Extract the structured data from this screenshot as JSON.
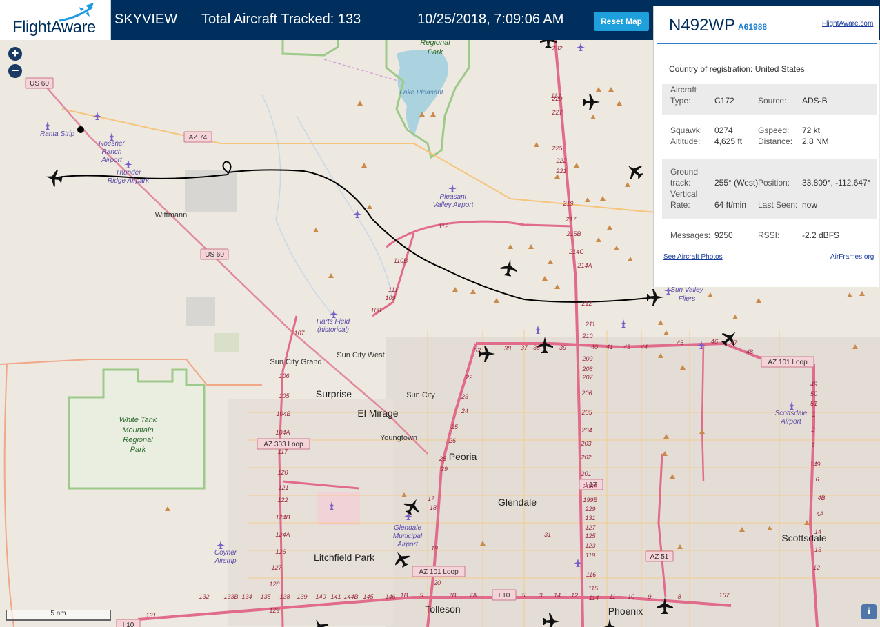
{
  "header": {
    "logo_text": "FlightAware",
    "title": "SKYVIEW",
    "total_label": "Total Aircraft Tracked: 133",
    "datetime": "10/25/2018, 7:09:06 AM",
    "reset_button": "Reset Map"
  },
  "map": {
    "zoom_in": "+",
    "zoom_out": "−",
    "scale_label": "5 nm",
    "info_button": "i",
    "place_labels": [
      {
        "text": "Regional",
        "cls": "park"
      },
      {
        "text": "Park",
        "cls": "park"
      },
      {
        "text": "Lake Pleasant",
        "cls": "water"
      },
      {
        "text": "US 60",
        "cls": "shield"
      },
      {
        "text": "Ranta Strip",
        "cls": "airport"
      },
      {
        "text": "Roesner",
        "cls": "airport"
      },
      {
        "text": "Ranch",
        "cls": "airport"
      },
      {
        "text": "Airport",
        "cls": "airport"
      },
      {
        "text": "AZ 74",
        "cls": "shield"
      },
      {
        "text": "Thunder",
        "cls": "airport"
      },
      {
        "text": "Ridge Airpark",
        "cls": "airport"
      },
      {
        "text": "Pleasant",
        "cls": "airport"
      },
      {
        "text": "Valley Airport",
        "cls": "airport"
      },
      {
        "text": "Wittmann",
        "cls": "town"
      },
      {
        "text": "US 60",
        "cls": "shield"
      },
      {
        "text": "Harts Field",
        "cls": "airport"
      },
      {
        "text": "(historical)",
        "cls": "airport"
      },
      {
        "text": "Sun City Grand",
        "cls": "town"
      },
      {
        "text": "Sun City West",
        "cls": "town"
      },
      {
        "text": "Surprise",
        "cls": "city"
      },
      {
        "text": "Sun City",
        "cls": "town"
      },
      {
        "text": "El Mirage",
        "cls": "city"
      },
      {
        "text": "Youngtown",
        "cls": "town"
      },
      {
        "text": "White Tank",
        "cls": "park"
      },
      {
        "text": "Mountain",
        "cls": "park"
      },
      {
        "text": "Regional",
        "cls": "park"
      },
      {
        "text": "Park",
        "cls": "park"
      },
      {
        "text": "AZ 303 Loop",
        "cls": "shield"
      },
      {
        "text": "Peoria",
        "cls": "city"
      },
      {
        "text": "Glendale",
        "cls": "city"
      },
      {
        "text": "Glendale",
        "cls": "airport"
      },
      {
        "text": "Municipal",
        "cls": "airport"
      },
      {
        "text": "Airport",
        "cls": "airport"
      },
      {
        "text": "Coyner",
        "cls": "airport"
      },
      {
        "text": "Airstrip",
        "cls": "airport"
      },
      {
        "text": "Litchfield Park",
        "cls": "city"
      },
      {
        "text": "AZ 101 Loop",
        "cls": "shield"
      },
      {
        "text": "Tolleson",
        "cls": "city"
      },
      {
        "text": "I 10",
        "cls": "shield"
      },
      {
        "text": "I 17",
        "cls": "shield"
      },
      {
        "text": "AZ 51",
        "cls": "shield"
      },
      {
        "text": "Phoenix",
        "cls": "city"
      },
      {
        "text": "Sun Valley",
        "cls": "airport"
      },
      {
        "text": "Fliers",
        "cls": "airport"
      },
      {
        "text": "AZ 101 Loop",
        "cls": "shield"
      },
      {
        "text": "Scottsdale",
        "cls": "airport"
      },
      {
        "text": "Airport",
        "cls": "airport"
      },
      {
        "text": "Scottsdale",
        "cls": "city"
      },
      {
        "text": "I 10",
        "cls": "shield"
      }
    ],
    "exit_numbers": [
      "232",
      "229",
      "227",
      "225",
      "222",
      "221",
      "219",
      "217",
      "215B",
      "214C",
      "214A",
      "212",
      "211",
      "210",
      "209",
      "208",
      "207",
      "206",
      "205",
      "204",
      "203",
      "202",
      "201",
      "200A",
      "199B",
      "229",
      "131",
      "127",
      "125",
      "123",
      "119",
      "116",
      "115",
      "114",
      "113",
      "112",
      "110B",
      "111",
      "109",
      "108",
      "107",
      "106",
      "105",
      "104B",
      "104A",
      "117",
      "120",
      "121",
      "122",
      "124B",
      "124A",
      "126",
      "127",
      "128",
      "129",
      "131",
      "132",
      "133B",
      "134",
      "135",
      "138",
      "139",
      "140",
      "141",
      "144B",
      "145",
      "146",
      "1B",
      "5",
      "7B",
      "7A",
      "5",
      "3",
      "14",
      "12",
      "11",
      "10",
      "9",
      "8",
      "157",
      "17",
      "18",
      "19",
      "20",
      "22",
      "23",
      "24",
      "25",
      "26",
      "28",
      "29",
      "31",
      "32",
      "38",
      "37",
      "38",
      "39",
      "40",
      "41",
      "43",
      "44",
      "45",
      "46",
      "47",
      "48",
      "49",
      "50",
      "51",
      "1",
      "2",
      "3",
      "149",
      "6",
      "4B",
      "4A",
      "14",
      "13",
      "12"
    ]
  },
  "panel": {
    "registration": "N492WP",
    "hex": "A61988",
    "link": "FlightAware.com",
    "country_label": "Country of registration:",
    "country": "United States",
    "aircraft_type_label_1": "Aircraft",
    "aircraft_type_label_2": "Type:",
    "aircraft_type": "C172",
    "source_label": "Source:",
    "source": "ADS-B",
    "squawk_label": "Squawk:",
    "squawk": "0274",
    "gspeed_label": "Gspeed:",
    "gspeed": "72 kt",
    "altitude_label": "Altitude:",
    "altitude": "4,625 ft",
    "distance_label": "Distance:",
    "distance": "2.8 NM",
    "track_label_1": "Ground",
    "track_label_2": "track:",
    "track": "255° (West)",
    "position_label": "Position:",
    "position": "33.809°, -112.647°",
    "vrate_label_1": "Vertical",
    "vrate_label_2": "Rate:",
    "vrate": "64 ft/min",
    "last_seen_label": "Last Seen:",
    "last_seen": "now",
    "messages_label": "Messages:",
    "messages": "9250",
    "rssi_label": "RSSI:",
    "rssi": "-2.2 dBFS",
    "photos_link": "See Aircraft Photos",
    "airframes_link": "AirFrames.org"
  },
  "colors": {
    "header_bg": "#002f5d",
    "accent": "#1ea0dc",
    "highway": "#e06b8a",
    "arterial": "#f6c47a",
    "park_border": "#9dca8a",
    "airport": "#7b5fc7"
  }
}
